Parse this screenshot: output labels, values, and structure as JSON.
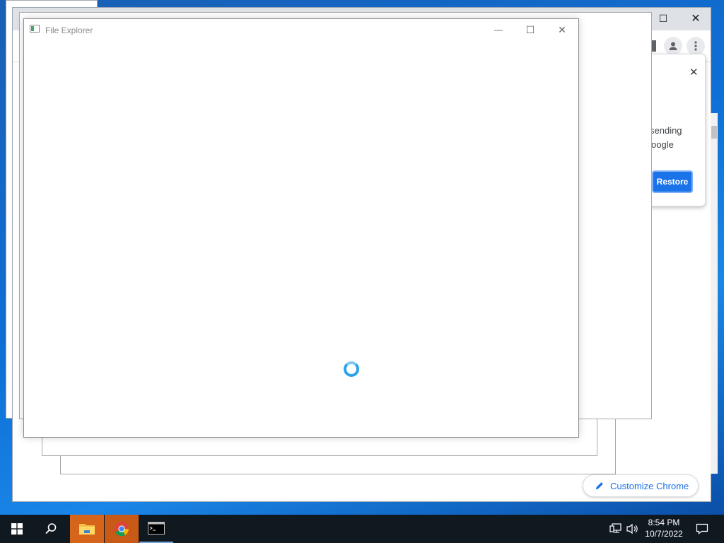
{
  "file_explorer": {
    "title": "File Explorer",
    "controls": {
      "minimize": "—",
      "maximize": "☐",
      "close": "✕"
    }
  },
  "chrome": {
    "controls": {
      "maximize": "☐",
      "close": "✕"
    },
    "restore_bubble": {
      "close": "✕",
      "line1": "sending",
      "line2": "oogle",
      "restore_label": "Restore"
    },
    "customize_label": "Customize Chrome"
  },
  "taskbar": {
    "time": "8:54 PM",
    "date": "10/7/2022"
  },
  "icons": {
    "start": "windows-logo-icon",
    "search": "search-icon",
    "file_explorer": "folder-icon",
    "chrome": "chrome-icon",
    "terminal": "terminal-icon",
    "network": "network-icon",
    "volume": "volume-icon",
    "notifications": "notification-icon",
    "edit": "pencil-icon"
  },
  "colors": {
    "accent": "#1a73e8",
    "taskbar": "#101820",
    "taskbar_active": "#d6641b",
    "spinner": "#2aa3e8"
  }
}
